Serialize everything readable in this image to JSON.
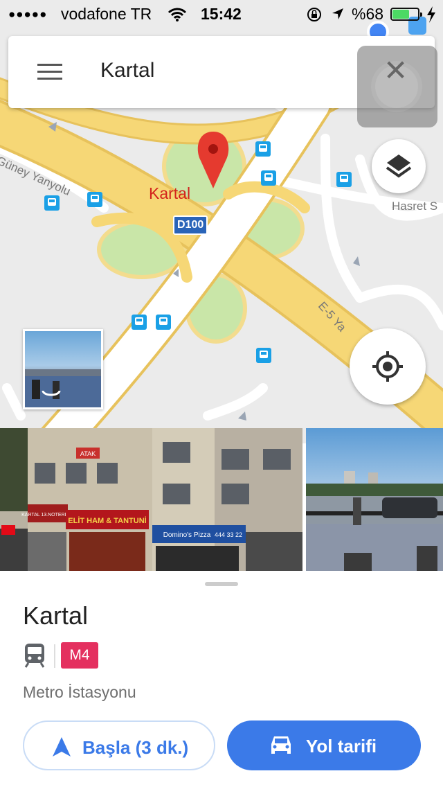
{
  "status_bar": {
    "signal": "●●●●●",
    "carrier": "vodafone TR",
    "time": "15:42",
    "battery_percent_label": "%68",
    "battery_level": 0.68
  },
  "search": {
    "query": "Kartal"
  },
  "map": {
    "place_label": "Kartal",
    "highway_shield": "D100",
    "road_labels": {
      "guney": "Güney Yanyolu",
      "hasret": "Hasret S",
      "e5": "E-5 Ya"
    },
    "colors": {
      "background": "#ebebeb",
      "highway": "#f6d776",
      "highway_edge": "#e7c25c",
      "park": "#c9e6a8",
      "pin": "#e53a2f",
      "bus": "#1aa0e6"
    }
  },
  "place": {
    "name": "Kartal",
    "badge": "M4",
    "badge_color": "#e4305f",
    "category": "Metro İstasyonu"
  },
  "actions": {
    "start_label": "Başla (3 dk.)",
    "directions_label": "Yol tarifi",
    "accent": "#3b7ae8"
  },
  "photos": {
    "shop_signs": {
      "atak": "ATAK",
      "noterligi": "KARTAL 13.NOTERLİĞİ",
      "elit": "ELİT HAM & TANTUNİ",
      "dominos": "Domino's Pizza",
      "phone": "444 33 22"
    }
  }
}
